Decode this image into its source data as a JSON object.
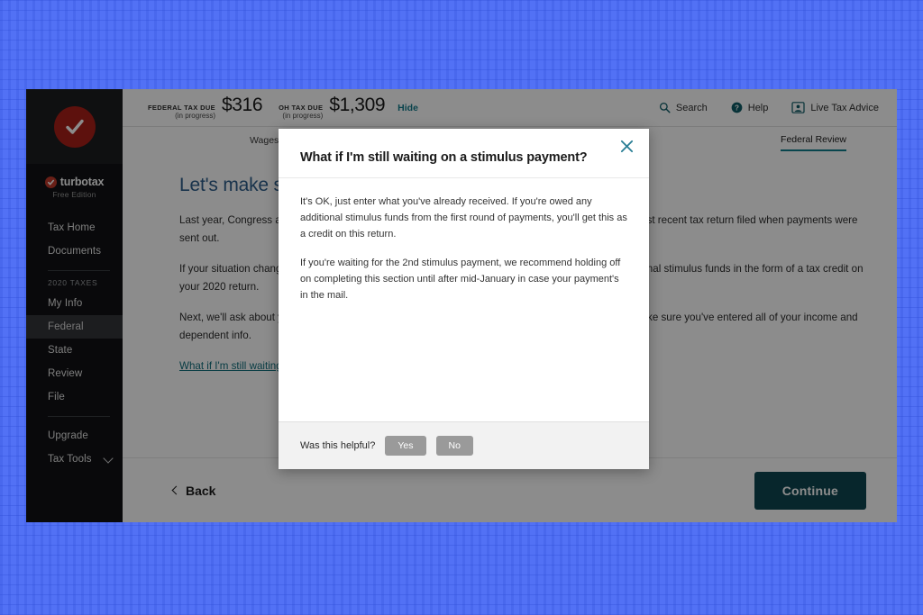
{
  "sidebar": {
    "brand_name": "turbotax",
    "brand_edition": "Free Edition",
    "items_top": [
      {
        "label": "Tax Home"
      },
      {
        "label": "Documents"
      }
    ],
    "group_label": "2020 TAXES",
    "items_tax": [
      {
        "label": "My Info",
        "active": false
      },
      {
        "label": "Federal",
        "active": true
      },
      {
        "label": "State",
        "active": false
      },
      {
        "label": "Review",
        "active": false
      },
      {
        "label": "File",
        "active": false
      }
    ],
    "items_bottom": [
      {
        "label": "Upgrade"
      },
      {
        "label": "Tax Tools"
      }
    ]
  },
  "topbar": {
    "federal": {
      "label": "FEDERAL TAX DUE",
      "sub": "(in progress)",
      "amount": "$316"
    },
    "state": {
      "label": "OH TAX DUE",
      "sub": "(in progress)",
      "amount": "$1,309"
    },
    "hide_label": "Hide",
    "actions": [
      {
        "label": "Search",
        "icon": "search-icon"
      },
      {
        "label": "Help",
        "icon": "help-icon"
      },
      {
        "label": "Live Tax Advice",
        "icon": "live-advice-icon"
      }
    ]
  },
  "tabs": [
    {
      "label": "Wages & Income",
      "active": false
    },
    {
      "label": "Federal Review",
      "active": true
    }
  ],
  "content": {
    "title": "Let's make sure you got the right stimulus amount",
    "paragraphs": [
      "Last year, Congress approved two rounds of stimulus payments. The amounts were based on the most recent tax return filed when payments were sent out.",
      "If your situation changed in 2020 (like a loss of income or a new baby), you may be eligible for additional stimulus funds in the form of a tax credit on your 2020 return.",
      "Next, we'll ask about your stimulus payments to see if you qualify for more. Before moving ahead, make sure you've entered all of your income and dependent info."
    ],
    "help_link": "What if I'm still waiting on a stimulus payment?"
  },
  "footer": {
    "back_label": "Back",
    "continue_label": "Continue"
  },
  "modal": {
    "title": "What if I'm still waiting on a stimulus payment?",
    "paragraphs": [
      "It's OK, just enter what you've already received. If you're owed any additional stimulus funds from the first round of payments, you'll get this as a credit on this return.",
      "If you're waiting for the 2nd stimulus payment, we recommend holding off on completing this section until after mid-January in case your payment's in the mail."
    ],
    "helpful_question": "Was this helpful?",
    "yes_label": "Yes",
    "no_label": "No"
  },
  "colors": {
    "accent_teal": "#0f7f8c",
    "continue_bg": "#0d4650",
    "brand_red": "#a91f18",
    "title_blue": "#2e5e8a",
    "page_bg": "#5271f5"
  }
}
